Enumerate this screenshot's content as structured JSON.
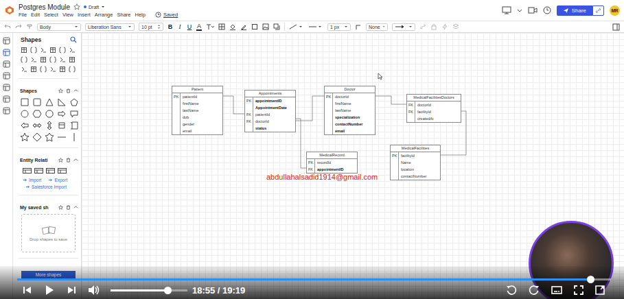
{
  "window": {
    "title": "Postgres Module",
    "starred": false,
    "status": "Draft",
    "saved": "Saved"
  },
  "menu": [
    "File",
    "Edit",
    "Select",
    "View",
    "Insert",
    "Arrange",
    "Share",
    "Help"
  ],
  "header": {
    "share_button": "Share",
    "avatar": "MR"
  },
  "toolbar": {
    "style": "Body",
    "font": "Liberation Sans",
    "size": "10 pt",
    "bold": "B",
    "italic": "I",
    "underline": "U",
    "text_color": "A",
    "line_width": "1 px",
    "line_start": "None"
  },
  "sidebar": {
    "title": "Shapes",
    "sections": [
      {
        "title": "Shapes",
        "kind": "shapes",
        "expanded": true
      },
      {
        "title": "Entity Relati",
        "kind": "entity",
        "expanded": true
      },
      {
        "title": "My saved sh",
        "kind": "saved",
        "expanded": true
      }
    ],
    "er_links": [
      "Import",
      "Export",
      "Salesforce Import"
    ],
    "drop_hint": "Drop shapes to save",
    "more_button": "More shapes"
  },
  "diagram": {
    "entities": [
      {
        "name": "Patient",
        "rows": [
          {
            "key": "PK",
            "field": "patientId",
            "bold": false
          },
          {
            "key": "",
            "field": "firstName",
            "bold": false
          },
          {
            "key": "",
            "field": "lastName",
            "bold": false
          },
          {
            "key": "",
            "field": "dob",
            "bold": false
          },
          {
            "key": "",
            "field": "gender",
            "bold": false
          },
          {
            "key": "",
            "field": "email",
            "bold": false
          }
        ]
      },
      {
        "name": "Appointments",
        "rows": [
          {
            "key": "PK",
            "field": "appointmentID",
            "bold": true
          },
          {
            "key": "",
            "field": "AppointmentDate",
            "bold": true
          },
          {
            "key": "FK",
            "field": "patientId",
            "bold": false
          },
          {
            "key": "FK",
            "field": "doctorId",
            "bold": false
          },
          {
            "key": "",
            "field": "status",
            "bold": true
          }
        ]
      },
      {
        "name": "Doctor",
        "rows": [
          {
            "key": "PK",
            "field": "doctorId",
            "bold": false
          },
          {
            "key": "",
            "field": "firstName",
            "bold": false
          },
          {
            "key": "",
            "field": "lastName",
            "bold": false
          },
          {
            "key": "",
            "field": "specialization",
            "bold": true
          },
          {
            "key": "",
            "field": "contactNumber",
            "bold": true
          },
          {
            "key": "",
            "field": "email",
            "bold": true
          }
        ]
      },
      {
        "name": "MedicalFacilitiesDoctors",
        "rows": [
          {
            "key": "FK",
            "field": "doctorId",
            "bold": false
          },
          {
            "key": "FK",
            "field": "facilityId",
            "bold": false
          },
          {
            "key": "",
            "field": "createdAt",
            "bold": false
          }
        ]
      },
      {
        "name": "MedicalRecord",
        "rows": [
          {
            "key": "PK",
            "field": "recordId",
            "bold": false
          },
          {
            "key": "FK",
            "field": "appointmentID",
            "bold": true
          }
        ]
      },
      {
        "name": "MedicalFacilities",
        "rows": [
          {
            "key": "PK",
            "field": "facilityId",
            "bold": false
          },
          {
            "key": "",
            "field": "Name",
            "bold": false
          },
          {
            "key": "",
            "field": "location",
            "bold": false
          },
          {
            "key": "",
            "field": "contactNumber",
            "bold": false
          }
        ]
      }
    ],
    "watermark": "abdullahalsadid1914@gmail.com"
  },
  "player": {
    "playing": false,
    "time": "18:55 / 19:19",
    "progress": 0.965,
    "volume": 0.74
  }
}
